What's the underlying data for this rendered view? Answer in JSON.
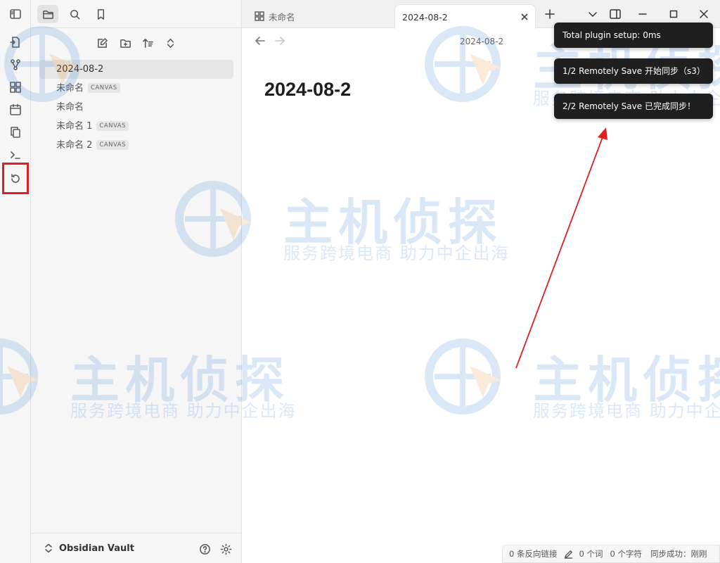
{
  "tabs": [
    {
      "label": "未命名",
      "icon": "canvas-grid-icon"
    },
    {
      "label": "2024-08-2",
      "icon": "none"
    }
  ],
  "sidebar": {
    "files": [
      {
        "name": "2024-08-2",
        "tag": ""
      },
      {
        "name": "未命名",
        "tag": "CANVAS"
      },
      {
        "name": "未命名",
        "tag": ""
      },
      {
        "name": "未命名 1",
        "tag": "CANVAS"
      },
      {
        "name": "未命名 2",
        "tag": "CANVAS"
      }
    ],
    "vault_name": "Obsidian Vault"
  },
  "view_header": {
    "title": "2024-08-2"
  },
  "document": {
    "title": "2024-08-2"
  },
  "notices": [
    "Total plugin setup: 0ms",
    "1/2 Remotely Save 开始同步（s3）",
    "2/2 Remotely Save 已完成同步！"
  ],
  "status_bar": {
    "backlinks": "0 条反向链接",
    "words": "0 个词",
    "chars": "0 个字符",
    "sync": "同步成功：刚刚"
  },
  "watermark": {
    "brand": "主机侦探",
    "slogan": "服务跨境电商 助力中企出海"
  },
  "colors": {
    "highlight_box": "#e02020",
    "annotation_arrow": "#e02020",
    "accent": "#3a7fd4"
  }
}
